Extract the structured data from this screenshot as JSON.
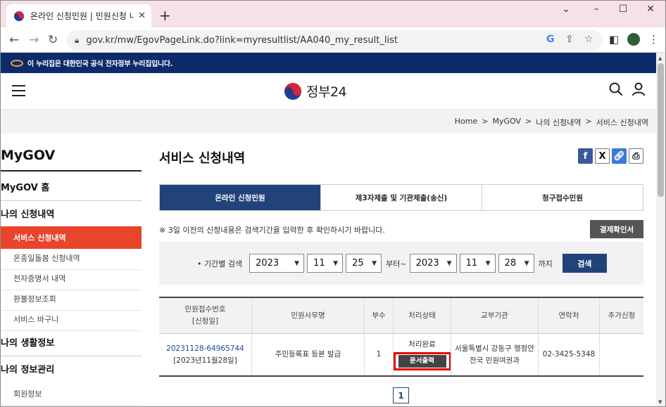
{
  "browser": {
    "tab_title": "온라인 신청민원 | 민원신청 내역",
    "url": "gov.kr/mw/EgovPageLink.do?link=myresultlist/AA040_my_result_list",
    "newtab_icon": "plus-icon"
  },
  "gov_banner": {
    "text": "이 누리집은 대한민국 공식 전자정부 누리집입니다."
  },
  "header": {
    "logo_text": "정부24"
  },
  "breadcrumb": [
    "Home",
    ">",
    "MyGOV",
    ">",
    "나의 신청내역",
    ">",
    "서비스 신청내역"
  ],
  "sidebar": {
    "title": "MyGOV",
    "home": "MyGOV 홈",
    "my_applications": "나의 신청내역",
    "sub_items": [
      "서비스 신청내역",
      "온종일돌봄 신청내역",
      "전자증명서 내역",
      "환불정보조회",
      "서비스 바구니"
    ],
    "life_info": "나의 생활정보",
    "info_manage": "나의 정보관리",
    "member_info": "회원정보"
  },
  "main": {
    "title": "서비스 신청내역",
    "tabs": [
      "온라인 신청민원",
      "제3자제출 및 기관제출(송신)",
      "청구접수민원"
    ],
    "note": "※ 3일 이전의 신청내용은 검색기간을 입력한 후 확인하시기 바랍니다.",
    "confirm_btn": "결제확인서",
    "search": {
      "label": "• 기간별 검색",
      "from_year": "2023",
      "from_month": "11",
      "from_day": "25",
      "from_text": "부터~",
      "to_year": "2023",
      "to_month": "11",
      "to_day": "28",
      "to_text": "까지",
      "button": "검색"
    },
    "table": {
      "headers": {
        "no_line1": "민원접수번호",
        "no_line2": "[신청일]",
        "name": "민원사무명",
        "count": "부수",
        "status": "처리상태",
        "agency": "교부기관",
        "contact": "연락처",
        "extra": "추가신청"
      },
      "row": {
        "no": "20231128-64965744",
        "date": "[2023년11월28일]",
        "name": "주민등록표 등본 발급",
        "count": "1",
        "status": "처리완료",
        "print": "문서출력",
        "agency_line1": "서울특별시 강동구 행정안",
        "agency_line2": "전국 민원여권과",
        "contact": "02-3425-5348",
        "extra": ""
      }
    },
    "page": "1"
  }
}
